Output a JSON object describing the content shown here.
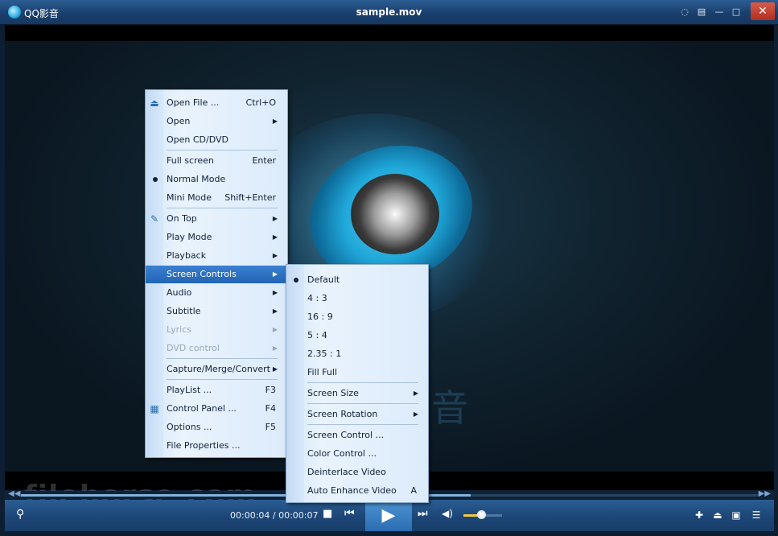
{
  "app": {
    "name": "QQ影音",
    "window_title": "sample.mov"
  },
  "titlebar_icons": [
    "chat-icon",
    "skin-icon",
    "minimize-icon",
    "maximize-icon",
    "close-icon"
  ],
  "player": {
    "time": "00:00:04 / 00:00:07",
    "progress_fraction": 0.61,
    "volume_fraction": 0.45,
    "watermark": "filehorse.com",
    "backdrop_char": "音"
  },
  "main_menu": [
    {
      "label": "Open File ...",
      "shortcut": "Ctrl+O",
      "icon": "eject-icon"
    },
    {
      "label": "Open",
      "submenu": true
    },
    {
      "label": "Open CD/DVD"
    },
    {
      "label": "Full screen",
      "shortcut": "Enter"
    },
    {
      "label": "Normal Mode",
      "checked": true
    },
    {
      "label": "Mini Mode",
      "shortcut": "Shift+Enter"
    },
    {
      "label": "On Top",
      "submenu": true,
      "icon": "pin-icon"
    },
    {
      "label": "Play Mode",
      "submenu": true
    },
    {
      "label": "Playback",
      "submenu": true
    },
    {
      "label": "Screen Controls",
      "submenu": true,
      "active": true
    },
    {
      "label": "Audio",
      "submenu": true
    },
    {
      "label": "Subtitle",
      "submenu": true
    },
    {
      "label": "Lyrics",
      "submenu": true,
      "disabled": true
    },
    {
      "label": "DVD control",
      "submenu": true,
      "disabled": true
    },
    {
      "label": "Capture/Merge/Convert",
      "submenu": true
    },
    {
      "label": "PlayList ...",
      "shortcut": "F3"
    },
    {
      "label": "Control Panel ...",
      "shortcut": "F4",
      "icon": "control-panel-icon"
    },
    {
      "label": "Options ...",
      "shortcut": "F5"
    },
    {
      "label": "File Properties ..."
    }
  ],
  "sub_menu": [
    {
      "label": "Default",
      "checked": true
    },
    {
      "label": "4 : 3"
    },
    {
      "label": "16 : 9"
    },
    {
      "label": "5 : 4"
    },
    {
      "label": "2.35 : 1"
    },
    {
      "label": "Fill Full"
    },
    {
      "label": "Screen Size",
      "submenu": true
    },
    {
      "label": "Screen Rotation",
      "submenu": true
    },
    {
      "label": "Screen Control ..."
    },
    {
      "label": "Color Control ..."
    },
    {
      "label": "Deinterlace Video"
    },
    {
      "label": "Auto Enhance Video",
      "shortcut": "A"
    }
  ],
  "colors": {
    "accent": "#2265b5",
    "titlebar": "#1a3f6d",
    "close": "#b02e20"
  }
}
